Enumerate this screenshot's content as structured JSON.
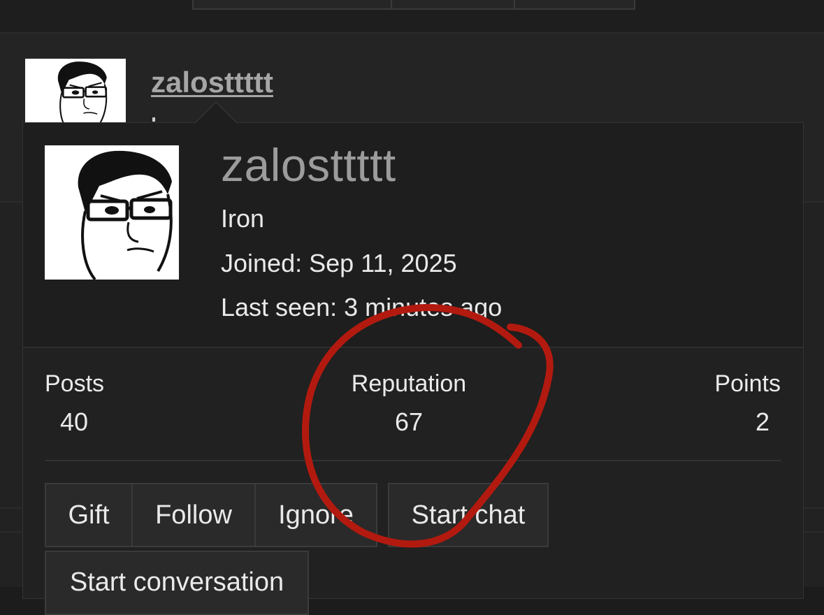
{
  "post": {
    "username": "zalosttttt"
  },
  "card": {
    "username": "zalosttttt",
    "title": "Iron",
    "joined": "Joined: Sep 11, 2025",
    "last_seen": "Last seen: 3 minutes ago",
    "stats": {
      "posts_label": "Posts",
      "posts_value": "40",
      "reputation_label": "Reputation",
      "reputation_value": "67",
      "points_label": "Points",
      "points_value": "2"
    },
    "buttons": {
      "gift": "Gift",
      "follow": "Follow",
      "ignore": "Ignore",
      "start_chat": "Start chat",
      "start_conversation": "Start conversation"
    }
  },
  "colors": {
    "page_bg": "#1c1c1c",
    "card_bg": "#212121",
    "username": "#9c9c9c",
    "annotation": "#b31a0f"
  },
  "icons": {
    "avatar": "wojak-glasses-avatar"
  }
}
